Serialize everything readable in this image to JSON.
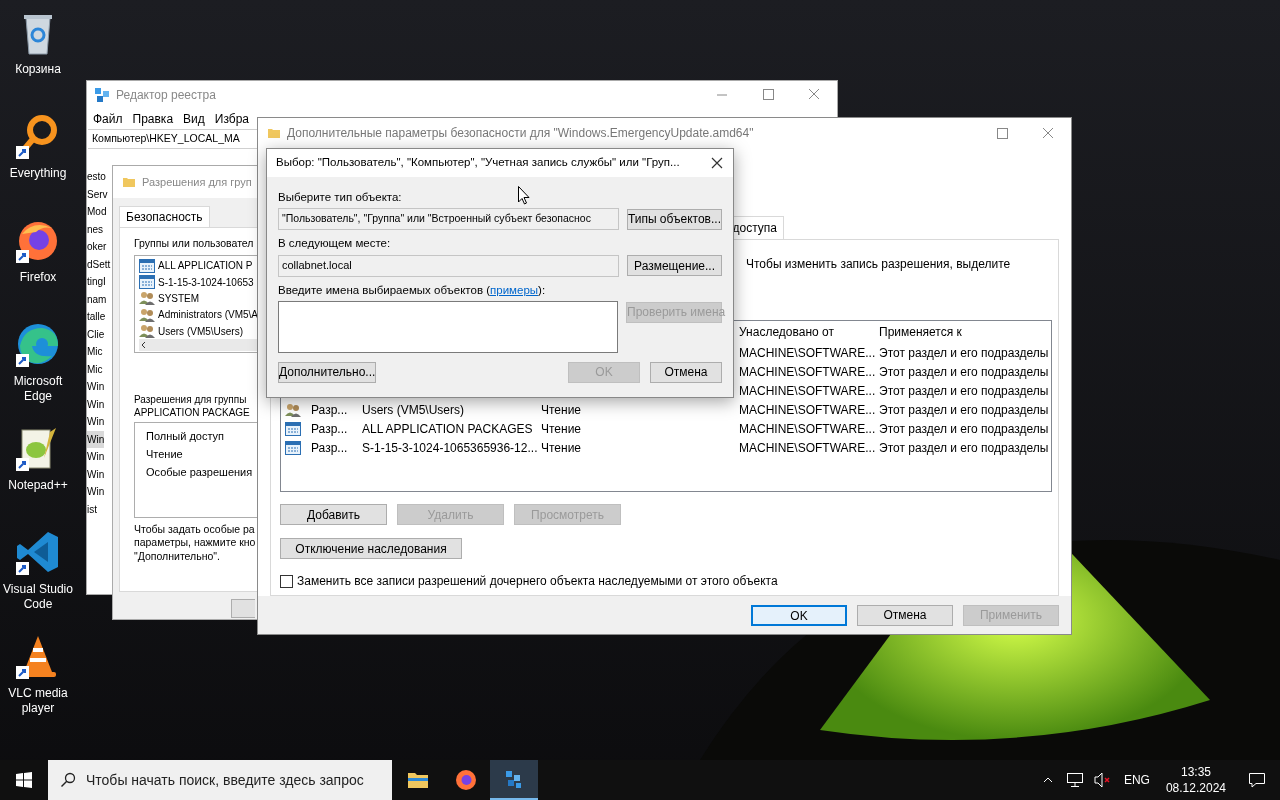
{
  "desktop_icons": [
    {
      "label": "Корзина",
      "kind": "recycle",
      "shortcut": false
    },
    {
      "label": "Everything",
      "kind": "everything",
      "shortcut": true
    },
    {
      "label": "Firefox",
      "kind": "firefox",
      "shortcut": true
    },
    {
      "label": "Microsoft Edge",
      "kind": "edge",
      "shortcut": true
    },
    {
      "label": "Notepad++",
      "kind": "notepad",
      "shortcut": true
    },
    {
      "label": "Visual Studio Code",
      "kind": "vscode",
      "shortcut": true
    },
    {
      "label": "VLC media player",
      "kind": "vlc",
      "shortcut": true
    }
  ],
  "registry_editor": {
    "title": "Редактор реестра",
    "menu": [
      "Файл",
      "Правка",
      "Вид",
      "Избра"
    ],
    "address": "Компьютер\\HKEY_LOCAL_MA",
    "tree": [
      {
        "label": "esto",
        "selected": false
      },
      {
        "label": "Serv",
        "selected": false
      },
      {
        "label": "Mod",
        "selected": false
      },
      {
        "label": "nes",
        "selected": false
      },
      {
        "label": "oker",
        "selected": false
      },
      {
        "label": "dSett",
        "selected": false
      },
      {
        "label": "tingI",
        "selected": false
      },
      {
        "label": "nam",
        "selected": false
      },
      {
        "label": "talle",
        "selected": false
      },
      {
        "label": "Clie",
        "selected": false
      },
      {
        "label": "Mic",
        "selected": false
      },
      {
        "label": "Mic",
        "selected": false
      },
      {
        "label": "Win",
        "selected": false
      },
      {
        "label": "Win",
        "selected": false
      },
      {
        "label": "Win",
        "selected": false
      },
      {
        "label": "Win",
        "selected": true
      },
      {
        "label": "Win",
        "selected": false
      },
      {
        "label": "Win",
        "selected": false
      },
      {
        "label": "Win",
        "selected": false
      },
      {
        "label": "ist",
        "selected": false
      }
    ]
  },
  "permissions_window": {
    "title": "Разрешения для груп",
    "tab": "Безопасность",
    "groups_label": "Группы или пользовател",
    "principals": [
      {
        "name": "ALL APPLICATION P",
        "kind": "package"
      },
      {
        "name": "S-1-15-3-1024-10653",
        "kind": "package"
      },
      {
        "name": "SYSTEM",
        "kind": "users"
      },
      {
        "name": "Administrators (VM5\\A",
        "kind": "users"
      },
      {
        "name": "Users (VM5\\Users)",
        "kind": "users"
      }
    ],
    "permissions_label": [
      "Разрешения для группы",
      "APPLICATION PACKAGE"
    ],
    "permissions": [
      "Полный доступ",
      "Чтение",
      "Особые разрешения"
    ],
    "hint": [
      "Чтобы задать особые ра",
      "параметры, нажмите кно",
      "\"Дополнительно\"."
    ]
  },
  "advanced_security": {
    "title": "Дополнительные параметры безопасности  для \"Windows.EmergencyUpdate.amd64\"",
    "tab": "доступа",
    "description": "Чтобы изменить запись разрешения, выделите",
    "table": {
      "columns": [
        "Унаследовано от",
        "Применяется к"
      ],
      "rows": [
        {
          "inherited": "MACHINE\\SOFTWARE...",
          "applies": "Этот раздел и его подразделы"
        },
        {
          "inherited": "MACHINE\\SOFTWARE...",
          "applies": "Этот раздел и его подразделы"
        },
        {
          "inherited": "MACHINE\\SOFTWARE...",
          "applies": "Этот раздел и его подразделы"
        },
        {
          "kind": "users",
          "type": "Разр...",
          "subject": "Users (VM5\\Users)",
          "access": "Чтение",
          "inherited": "MACHINE\\SOFTWARE...",
          "applies": "Этот раздел и его подразделы"
        },
        {
          "kind": "package",
          "type": "Разр...",
          "subject": "ALL APPLICATION PACKAGES",
          "access": "Чтение",
          "inherited": "MACHINE\\SOFTWARE...",
          "applies": "Этот раздел и его подразделы"
        },
        {
          "kind": "package",
          "type": "Разр...",
          "subject": "S-1-15-3-1024-1065365936-12...",
          "access": "Чтение",
          "inherited": "MACHINE\\SOFTWARE...",
          "applies": "Этот раздел и его подразделы"
        }
      ]
    },
    "entry_buttons": [
      {
        "label": "Добавить",
        "disabled": false
      },
      {
        "label": "Удалить",
        "disabled": true
      },
      {
        "label": "Просмотреть",
        "disabled": true
      }
    ],
    "inheritance_button": "Отключение наследования",
    "replace_checkbox": {
      "label": "Заменить все записи разрешений дочернего объекта наследуемыми от этого объекта",
      "checked": false
    },
    "footer_buttons": [
      {
        "label": "OK",
        "disabled": false,
        "default": true
      },
      {
        "label": "Отмена",
        "disabled": false,
        "default": false
      },
      {
        "label": "Применить",
        "disabled": true,
        "default": false
      }
    ]
  },
  "select_dialog": {
    "title": "Выбор: \"Пользователь\", \"Компьютер\", \"Учетная запись службы\" или \"Груп...",
    "object_type_label": "Выберите тип объекта:",
    "object_type_value": "\"Пользователь\", \"Группа\" или \"Встроенный субъект безопаснос",
    "object_types_button": "Типы объектов...",
    "location_label": "В следующем месте:",
    "location_value": "collabnet.local",
    "location_button": "Размещение...",
    "names_label_before": "Введите имена выбираемых объектов (",
    "names_link": "примеры",
    "names_label_after": "):",
    "check_names_button": {
      "label": "Проверить имена",
      "disabled": true
    },
    "advanced_button": "Дополнительно...",
    "ok_button": {
      "label": "OK",
      "disabled": true
    },
    "cancel_button": "Отмена"
  },
  "taskbar": {
    "search_placeholder": "Чтобы начать поиск, введите здесь запрос",
    "apps": [
      {
        "kind": "explorer",
        "selected": false
      },
      {
        "kind": "firefox",
        "selected": false
      },
      {
        "kind": "regedit",
        "selected": true
      }
    ],
    "language": "ENG",
    "time": "13:35",
    "date": "08.12.2024"
  }
}
